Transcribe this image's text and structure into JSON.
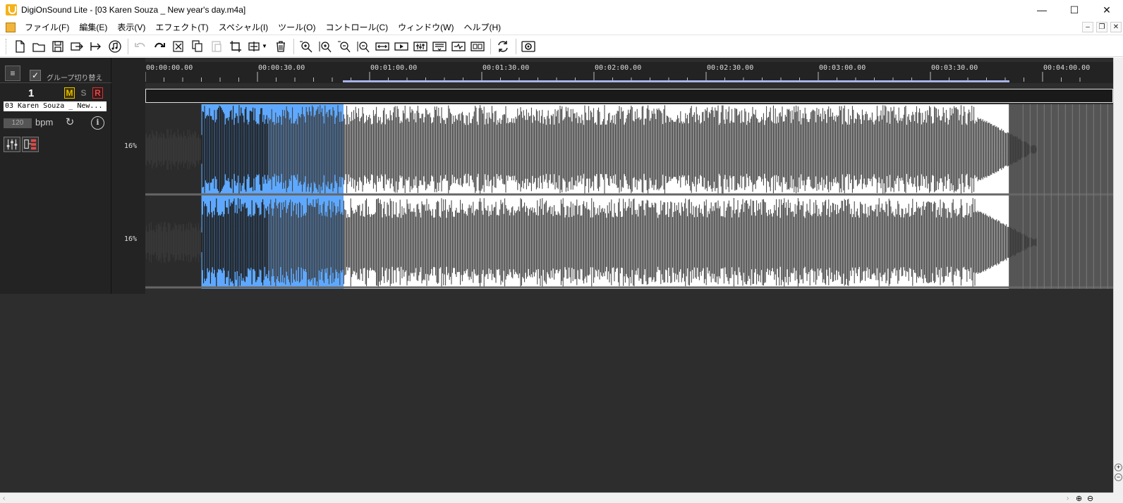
{
  "window": {
    "title": "DigiOnSound Lite - [03 Karen Souza _ New year's day.m4a]",
    "minimize": "—",
    "maximize": "☐",
    "close": "✕"
  },
  "menu": [
    {
      "label": "ファイル(F)"
    },
    {
      "label": "編集(E)"
    },
    {
      "label": "表示(V)"
    },
    {
      "label": "エフェクト(T)"
    },
    {
      "label": "スペシャル(I)"
    },
    {
      "label": "ツール(O)"
    },
    {
      "label": "コントロール(C)"
    },
    {
      "label": "ウィンドウ(W)"
    },
    {
      "label": "ヘルプ(H)"
    }
  ],
  "mdi": {
    "minimize": "–",
    "restore": "❐",
    "close": "✕"
  },
  "toolbar_icons": [
    "new-file-icon",
    "open-folder-icon",
    "save-icon",
    "export-icon",
    "send-icon",
    "music-icon",
    "undo-icon",
    "redo-icon",
    "cut-icon",
    "copy-icon",
    "paste-icon",
    "crop-icon",
    "trim-icon",
    "delete-icon",
    "zoom-in-icon",
    "zoom-selection-icon",
    "zoom-out-icon",
    "zoom-fit-icon",
    "fit-width-icon",
    "play-region-icon",
    "mixer-icon",
    "list-icon",
    "loop-icon",
    "grid-icon",
    "convert-icon",
    "monitor-icon"
  ],
  "panel": {
    "group_toggle_label": "グループ切り替え",
    "group_check": "✓",
    "sort_glyph": "≡"
  },
  "track": {
    "number": "1",
    "mute": "M",
    "solo": "S",
    "record": "R",
    "name": "03 Karen Souza _ New...",
    "bpm_value": "120",
    "bpm_label": "bpm",
    "reload_glyph": "↻",
    "info_glyph": "i",
    "channels": [
      {
        "scale": "16%"
      },
      {
        "scale": "16%"
      }
    ]
  },
  "ruler": {
    "ticks": [
      "00:00:00.00",
      "00:00:30.00",
      "00:01:00.00",
      "00:01:30.00",
      "00:02:00.00",
      "00:02:30.00",
      "00:03:00.00",
      "00:03:30.00",
      "00:04:00.00"
    ]
  },
  "waveform": {
    "duration_seconds": 240,
    "selection_seconds": [
      15,
      53
    ],
    "audio_end_seconds": 231,
    "colors": {
      "background_pre": "#2b2b2b",
      "selected_bg": "#5ea9ff",
      "selected_wave": "#1b1b1b",
      "unselected_bg": "#ffffff",
      "unselected_wave": "#3a3a3a",
      "tail_bg": "#555555"
    }
  },
  "colors": {
    "editor_bg": "#2d2d2d",
    "panel_bg": "#232323",
    "mute": "#e8c000",
    "record": "#e04a4a"
  }
}
